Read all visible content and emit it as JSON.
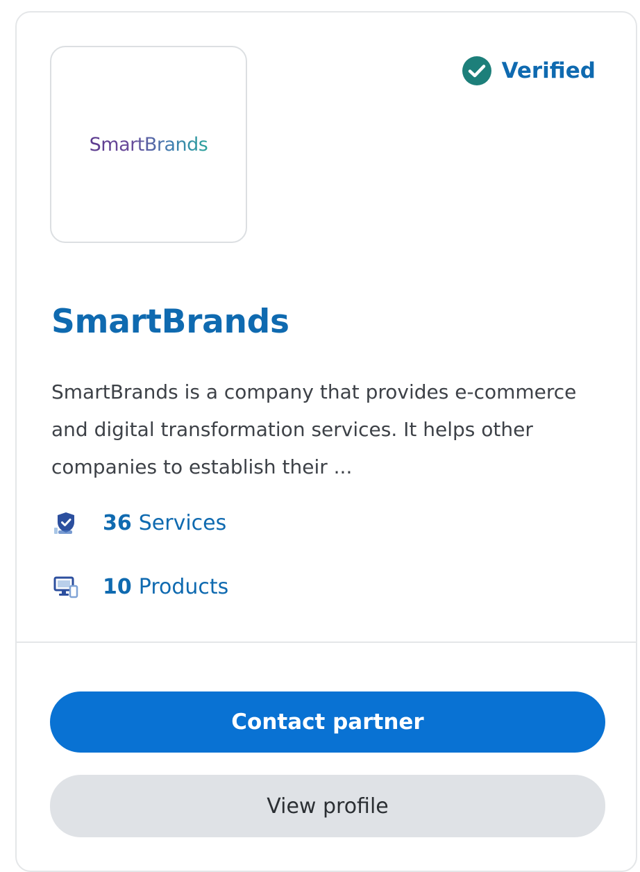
{
  "partner": {
    "logo_text": "SmartBrands",
    "verified_label": "Verified",
    "name": "SmartBrands",
    "description": "SmartBrands is a company that provides e-commerce and digital transformation services. It helps other companies to establish their ...",
    "stats": {
      "services": {
        "count": "36",
        "label": "Services",
        "icon": "services-shield-icon"
      },
      "products": {
        "count": "10",
        "label": "Products",
        "icon": "products-monitor-icon"
      }
    }
  },
  "actions": {
    "contact_label": "Contact partner",
    "view_profile_label": "View profile"
  },
  "colors": {
    "link_blue": "#0f6ab0",
    "primary_button": "#0972d3",
    "secondary_button": "#dfe2e6",
    "verified_badge": "#1d7f7a"
  }
}
